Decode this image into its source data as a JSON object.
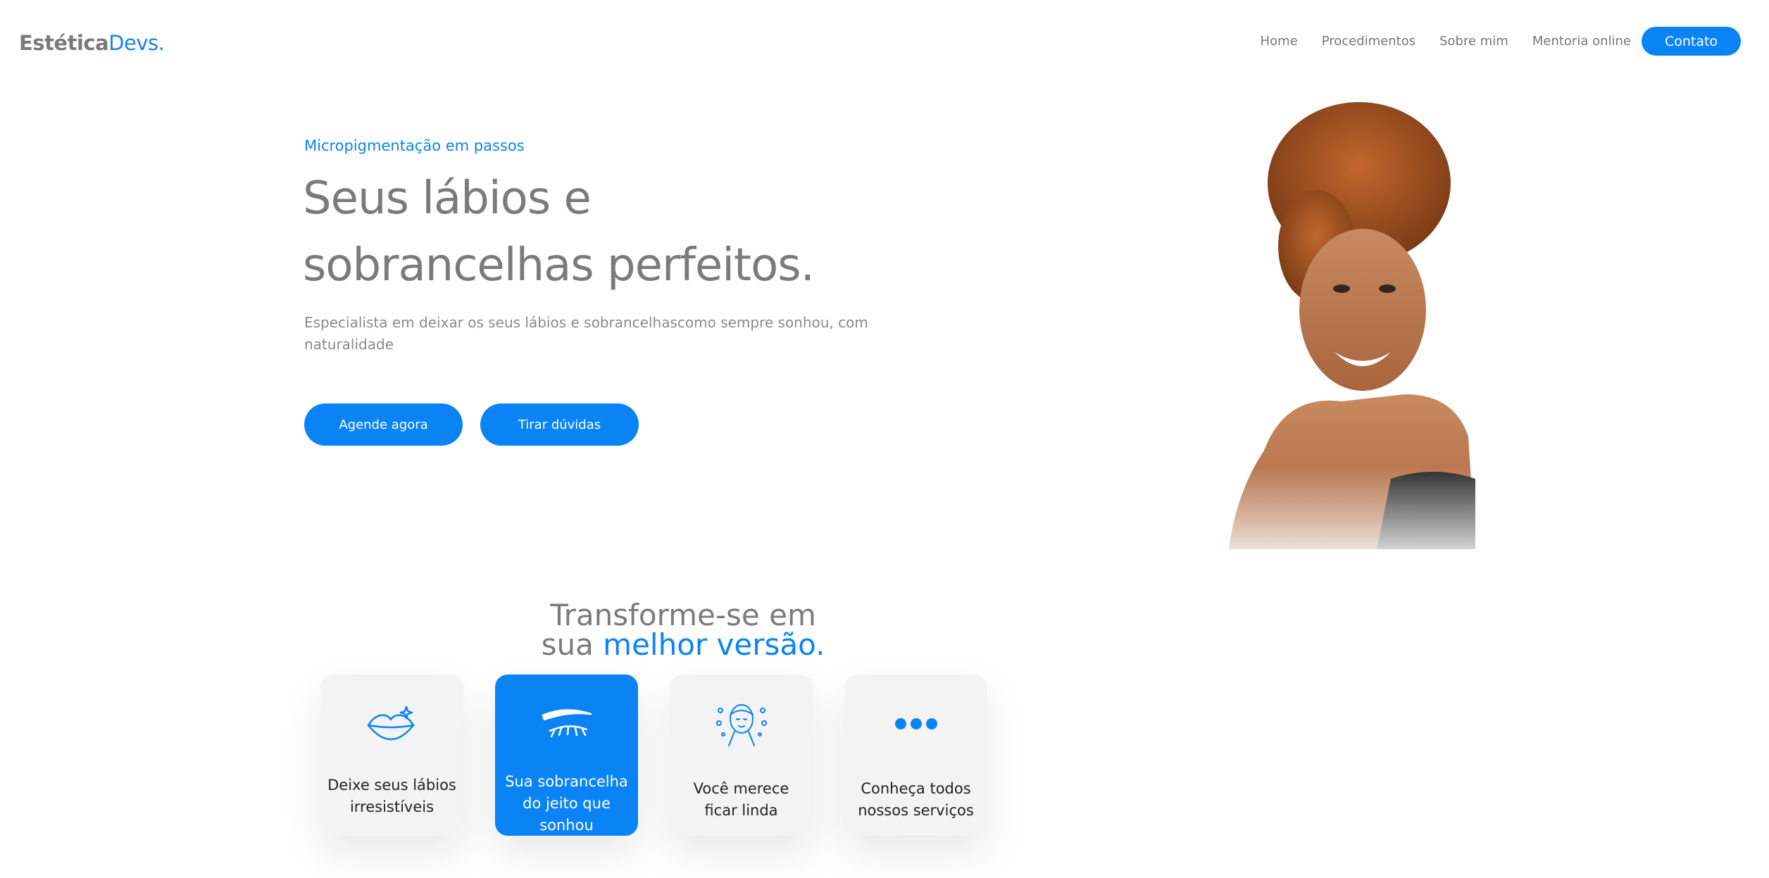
{
  "header": {
    "logo_main": "Estética",
    "logo_accent": "Devs.",
    "nav": [
      "Home",
      "Procedimentos",
      "Sobre mim",
      "Mentoria online"
    ],
    "contact_label": "Contato"
  },
  "hero": {
    "eyebrow": "Micropigmentação em passos",
    "title_line1": "Seus lábios e",
    "title_line2": "sobrancelhas perfeitos.",
    "description": "Especialista em deixar os seus lábios e sobrancelhascomo sempre sonhou, com naturalidade",
    "primary_button": "Agende agora",
    "secondary_button": "Tirar dúvidas"
  },
  "section": {
    "title_line1": "Transforme-se em",
    "title_prefix": "sua ",
    "title_highlight": "melhor versão.",
    "cards": [
      {
        "label": "Deixe seus lábios irresistíveis",
        "icon": "lips-icon"
      },
      {
        "label": "Sua sobrancelha do jeito que sonhou",
        "icon": "eyebrow-icon"
      },
      {
        "label": "Você merece ficar linda",
        "icon": "face-icon"
      },
      {
        "label": "Conheça todos nossos serviços",
        "icon": "more-dots-icon"
      }
    ]
  },
  "colors": {
    "accent": "#0a84f5",
    "text_gray": "#7b7b7b",
    "card_bg": "#f3f3f3"
  }
}
